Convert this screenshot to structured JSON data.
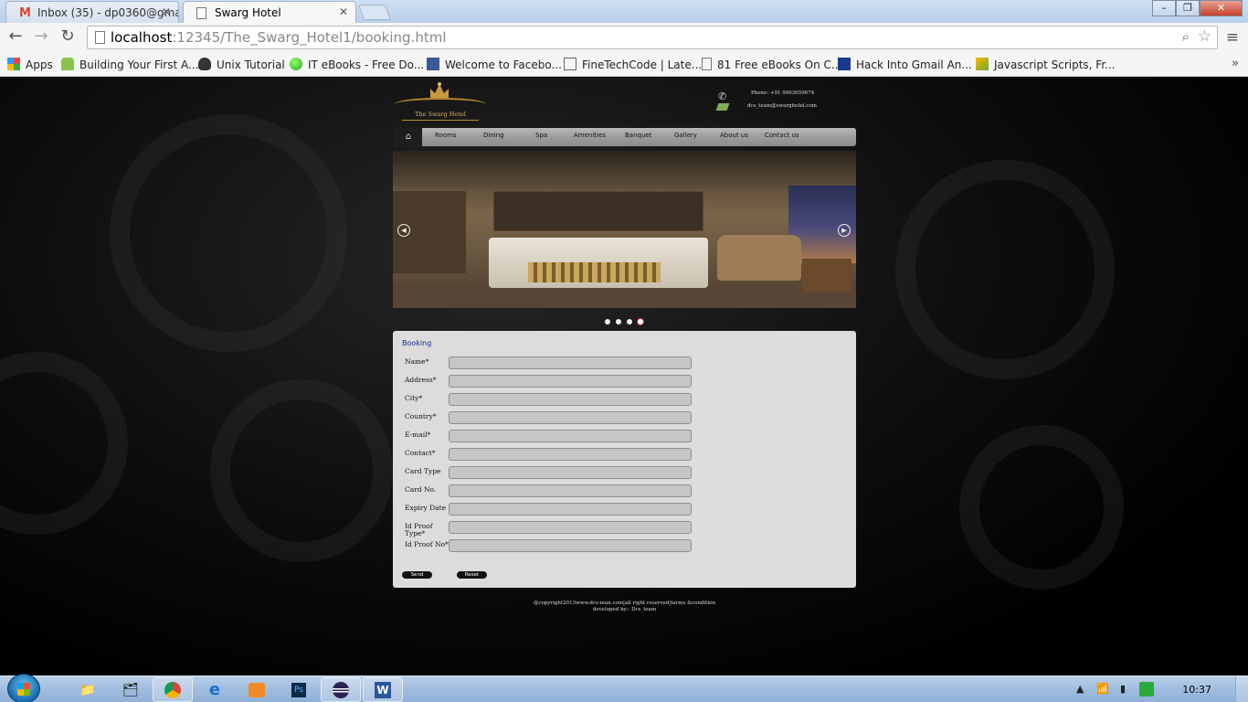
{
  "browser": {
    "tabs": [
      {
        "title": "Inbox (35) - dp0360@gma",
        "icon": "gmail-icon"
      },
      {
        "title": "Swarg Hotel",
        "icon": "page-icon"
      }
    ],
    "url_host": "localhost",
    "url_rest": ":12345/The_Swarg_Hotel1/booking.html",
    "bookmarks": [
      {
        "label": "Apps",
        "icon": "apps-grid-icon"
      },
      {
        "label": "Building Your First A...",
        "icon": "android-icon"
      },
      {
        "label": "Unix Tutorial",
        "icon": "tux-icon"
      },
      {
        "label": "IT eBooks - Free Do...",
        "icon": "green-ball-icon"
      },
      {
        "label": "Welcome to Facebo...",
        "icon": "facebook-icon"
      },
      {
        "label": "FineTechCode | Late...",
        "icon": "ftc-icon"
      },
      {
        "label": "81 Free eBooks On C...",
        "icon": "page-icon"
      },
      {
        "label": "Hack Into Gmail An...",
        "icon": "efy-icon"
      },
      {
        "label": "Javascript Scripts, Fr...",
        "icon": "script-icon"
      }
    ]
  },
  "site": {
    "logo_text": "The Swarg Hotel",
    "phone": "Phone:  +91 9903059674",
    "email": "dcs_team@swarghotel.com",
    "menu": [
      "Rooms",
      "Dining",
      "Spa",
      "Amenities",
      "Banquet",
      "Gallery",
      "About us",
      "Contact us"
    ],
    "slider_dots": 4,
    "slider_active": 4,
    "booking": {
      "title": "Booking",
      "fields": [
        {
          "label": "Name*",
          "value": ""
        },
        {
          "label": "Address*",
          "value": ""
        },
        {
          "label": "City*",
          "value": ""
        },
        {
          "label": "Country*",
          "value": ""
        },
        {
          "label": "E-mail*",
          "value": ""
        },
        {
          "label": "Contact*",
          "value": ""
        },
        {
          "label": "Card Type",
          "value": ""
        },
        {
          "label": "Card No.",
          "value": ""
        },
        {
          "label": "Expiry Date",
          "value": ""
        },
        {
          "label": "Id Proof Type*",
          "value": ""
        },
        {
          "label": "Id Proof No*",
          "value": ""
        }
      ],
      "send_label": "Send",
      "reset_label": "Reset"
    },
    "footer_line1": "@copyright2013www.dcs-man.com|all right reserved|terms &condition",
    "footer_line2": "developed by:- Dcs_team"
  },
  "taskbar": {
    "apps": [
      "explorer-icon",
      "folders-icon",
      "chrome-icon",
      "ie-icon",
      "media-player-icon",
      "photoshop-icon",
      "eclipse-icon",
      "word-icon"
    ],
    "clock": "10:37"
  },
  "colors": {
    "accent_gold": "#b98a2e",
    "booking_title": "#1a2a8a",
    "panel_bg": "#dcdcdc"
  }
}
